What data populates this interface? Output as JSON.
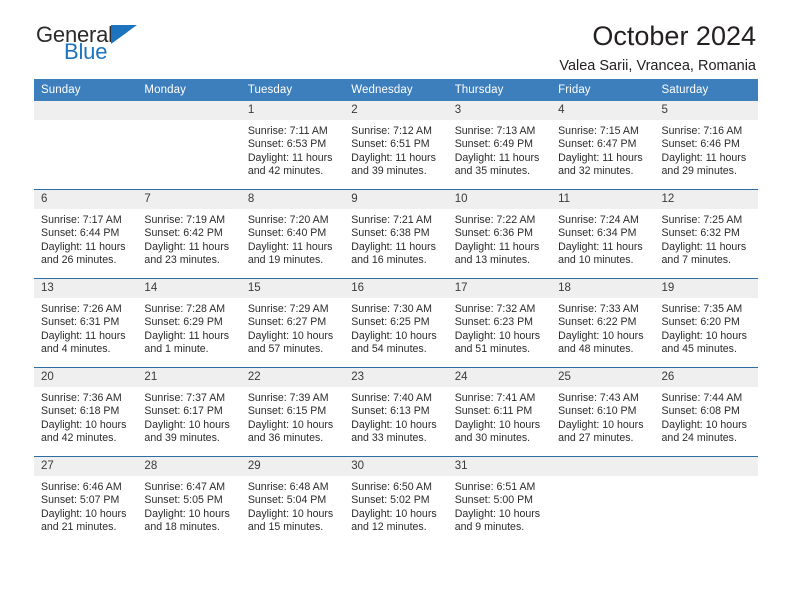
{
  "brand": {
    "general": "General",
    "blue": "Blue",
    "mark": "triangle-logo-icon"
  },
  "header": {
    "title": "October 2024",
    "subtitle": "Valea Sarii, Vrancea, Romania"
  },
  "weekday_headers": [
    "Sunday",
    "Monday",
    "Tuesday",
    "Wednesday",
    "Thursday",
    "Friday",
    "Saturday"
  ],
  "colors": {
    "header_blue": "#3d7ebd",
    "rule_blue": "#2e6da4",
    "daynum_band": "#efefef",
    "brand_blue": "#1e73be",
    "text": "#231f20"
  },
  "weeks": [
    [
      {
        "day": "",
        "empty": true
      },
      {
        "day": "",
        "empty": true
      },
      {
        "day": "1",
        "sunrise": "Sunrise: 7:11 AM",
        "sunset": "Sunset: 6:53 PM",
        "daylight": "Daylight: 11 hours and 42 minutes."
      },
      {
        "day": "2",
        "sunrise": "Sunrise: 7:12 AM",
        "sunset": "Sunset: 6:51 PM",
        "daylight": "Daylight: 11 hours and 39 minutes."
      },
      {
        "day": "3",
        "sunrise": "Sunrise: 7:13 AM",
        "sunset": "Sunset: 6:49 PM",
        "daylight": "Daylight: 11 hours and 35 minutes."
      },
      {
        "day": "4",
        "sunrise": "Sunrise: 7:15 AM",
        "sunset": "Sunset: 6:47 PM",
        "daylight": "Daylight: 11 hours and 32 minutes."
      },
      {
        "day": "5",
        "sunrise": "Sunrise: 7:16 AM",
        "sunset": "Sunset: 6:46 PM",
        "daylight": "Daylight: 11 hours and 29 minutes."
      }
    ],
    [
      {
        "day": "6",
        "sunrise": "Sunrise: 7:17 AM",
        "sunset": "Sunset: 6:44 PM",
        "daylight": "Daylight: 11 hours and 26 minutes."
      },
      {
        "day": "7",
        "sunrise": "Sunrise: 7:19 AM",
        "sunset": "Sunset: 6:42 PM",
        "daylight": "Daylight: 11 hours and 23 minutes."
      },
      {
        "day": "8",
        "sunrise": "Sunrise: 7:20 AM",
        "sunset": "Sunset: 6:40 PM",
        "daylight": "Daylight: 11 hours and 19 minutes."
      },
      {
        "day": "9",
        "sunrise": "Sunrise: 7:21 AM",
        "sunset": "Sunset: 6:38 PM",
        "daylight": "Daylight: 11 hours and 16 minutes."
      },
      {
        "day": "10",
        "sunrise": "Sunrise: 7:22 AM",
        "sunset": "Sunset: 6:36 PM",
        "daylight": "Daylight: 11 hours and 13 minutes."
      },
      {
        "day": "11",
        "sunrise": "Sunrise: 7:24 AM",
        "sunset": "Sunset: 6:34 PM",
        "daylight": "Daylight: 11 hours and 10 minutes."
      },
      {
        "day": "12",
        "sunrise": "Sunrise: 7:25 AM",
        "sunset": "Sunset: 6:32 PM",
        "daylight": "Daylight: 11 hours and 7 minutes."
      }
    ],
    [
      {
        "day": "13",
        "sunrise": "Sunrise: 7:26 AM",
        "sunset": "Sunset: 6:31 PM",
        "daylight": "Daylight: 11 hours and 4 minutes."
      },
      {
        "day": "14",
        "sunrise": "Sunrise: 7:28 AM",
        "sunset": "Sunset: 6:29 PM",
        "daylight": "Daylight: 11 hours and 1 minute."
      },
      {
        "day": "15",
        "sunrise": "Sunrise: 7:29 AM",
        "sunset": "Sunset: 6:27 PM",
        "daylight": "Daylight: 10 hours and 57 minutes."
      },
      {
        "day": "16",
        "sunrise": "Sunrise: 7:30 AM",
        "sunset": "Sunset: 6:25 PM",
        "daylight": "Daylight: 10 hours and 54 minutes."
      },
      {
        "day": "17",
        "sunrise": "Sunrise: 7:32 AM",
        "sunset": "Sunset: 6:23 PM",
        "daylight": "Daylight: 10 hours and 51 minutes."
      },
      {
        "day": "18",
        "sunrise": "Sunrise: 7:33 AM",
        "sunset": "Sunset: 6:22 PM",
        "daylight": "Daylight: 10 hours and 48 minutes."
      },
      {
        "day": "19",
        "sunrise": "Sunrise: 7:35 AM",
        "sunset": "Sunset: 6:20 PM",
        "daylight": "Daylight: 10 hours and 45 minutes."
      }
    ],
    [
      {
        "day": "20",
        "sunrise": "Sunrise: 7:36 AM",
        "sunset": "Sunset: 6:18 PM",
        "daylight": "Daylight: 10 hours and 42 minutes."
      },
      {
        "day": "21",
        "sunrise": "Sunrise: 7:37 AM",
        "sunset": "Sunset: 6:17 PM",
        "daylight": "Daylight: 10 hours and 39 minutes."
      },
      {
        "day": "22",
        "sunrise": "Sunrise: 7:39 AM",
        "sunset": "Sunset: 6:15 PM",
        "daylight": "Daylight: 10 hours and 36 minutes."
      },
      {
        "day": "23",
        "sunrise": "Sunrise: 7:40 AM",
        "sunset": "Sunset: 6:13 PM",
        "daylight": "Daylight: 10 hours and 33 minutes."
      },
      {
        "day": "24",
        "sunrise": "Sunrise: 7:41 AM",
        "sunset": "Sunset: 6:11 PM",
        "daylight": "Daylight: 10 hours and 30 minutes."
      },
      {
        "day": "25",
        "sunrise": "Sunrise: 7:43 AM",
        "sunset": "Sunset: 6:10 PM",
        "daylight": "Daylight: 10 hours and 27 minutes."
      },
      {
        "day": "26",
        "sunrise": "Sunrise: 7:44 AM",
        "sunset": "Sunset: 6:08 PM",
        "daylight": "Daylight: 10 hours and 24 minutes."
      }
    ],
    [
      {
        "day": "27",
        "sunrise": "Sunrise: 6:46 AM",
        "sunset": "Sunset: 5:07 PM",
        "daylight": "Daylight: 10 hours and 21 minutes."
      },
      {
        "day": "28",
        "sunrise": "Sunrise: 6:47 AM",
        "sunset": "Sunset: 5:05 PM",
        "daylight": "Daylight: 10 hours and 18 minutes."
      },
      {
        "day": "29",
        "sunrise": "Sunrise: 6:48 AM",
        "sunset": "Sunset: 5:04 PM",
        "daylight": "Daylight: 10 hours and 15 minutes."
      },
      {
        "day": "30",
        "sunrise": "Sunrise: 6:50 AM",
        "sunset": "Sunset: 5:02 PM",
        "daylight": "Daylight: 10 hours and 12 minutes."
      },
      {
        "day": "31",
        "sunrise": "Sunrise: 6:51 AM",
        "sunset": "Sunset: 5:00 PM",
        "daylight": "Daylight: 10 hours and 9 minutes."
      },
      {
        "day": "",
        "empty": true
      },
      {
        "day": "",
        "empty": true
      }
    ]
  ]
}
